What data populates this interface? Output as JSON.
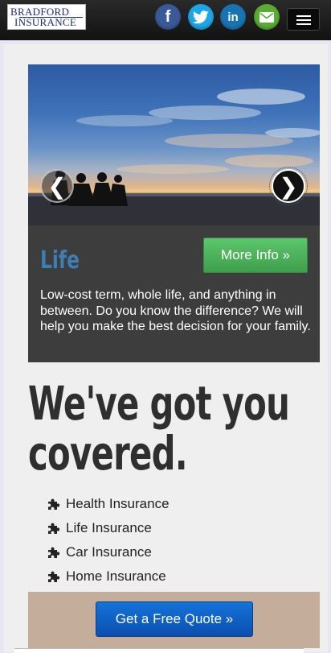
{
  "header": {
    "logo_line1": "BRADFORD",
    "logo_line2": "INSURANCE",
    "social": [
      "facebook-icon",
      "twitter-icon",
      "linkedin-icon",
      "email-icon"
    ],
    "social_glyphs": {
      "facebook": "f",
      "linkedin": "in"
    }
  },
  "slider": {
    "prev_symbol": "❮",
    "next_symbol": "❯",
    "title": "Life",
    "button_label": "More Info »",
    "description": "Low-cost term, whole life, and anything in between. Do you know the difference? We will help you make the best decision for your family."
  },
  "headline": {
    "line1": "We've got you",
    "line2": "covered."
  },
  "services": [
    "Health Insurance",
    "Life Insurance",
    "Car Insurance",
    "Home Insurance"
  ],
  "cta": {
    "label": "Get a Free Quote »"
  },
  "colors": {
    "accent_blue": "#3d7fb4",
    "button_green": "#4cae5a",
    "cta_blue": "#0f60c4",
    "quote_bar": "#c5ad9c"
  }
}
